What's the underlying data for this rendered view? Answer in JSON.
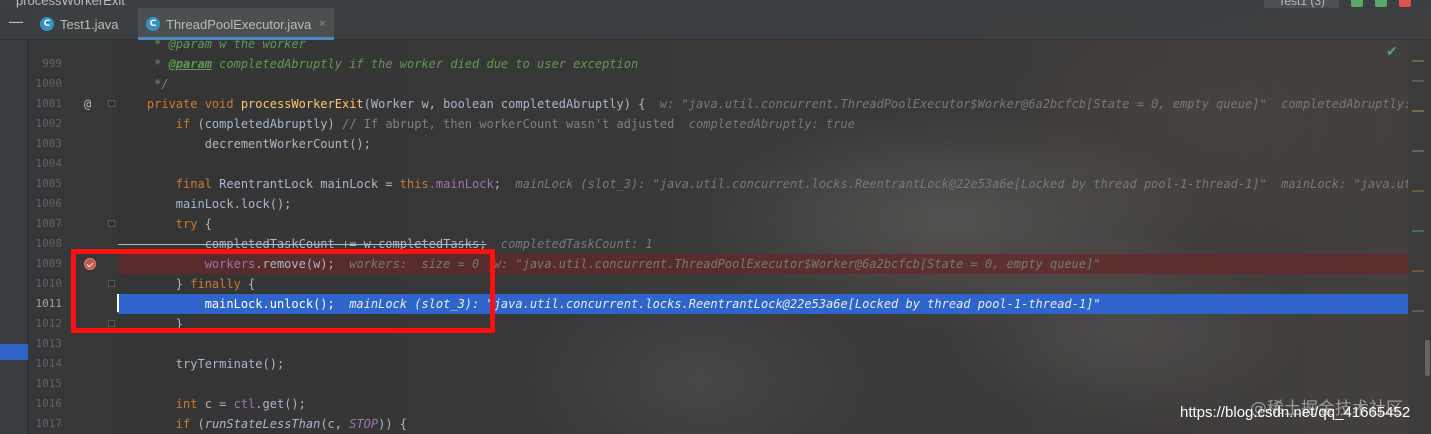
{
  "window": {
    "title": "processWorkerExit"
  },
  "toolbar": {
    "run_config": "Test1 (3)"
  },
  "tabs": [
    {
      "label": "Test1.java",
      "icon": "java-class-icon",
      "active": false
    },
    {
      "label": "ThreadPoolExecutor.java",
      "icon": "java-class-icon",
      "active": true,
      "close": "×"
    }
  ],
  "gutter": {
    "line_numbers": [
      "999",
      "1000",
      "1001",
      "1002",
      "1003",
      "1004",
      "1005",
      "1006",
      "1007",
      "1008",
      "1009",
      "1010",
      "1011",
      "1012",
      "1013",
      "1014",
      "1015",
      "1016",
      "1017"
    ],
    "first_partial": "",
    "override_marker": "@",
    "current_line": "1011",
    "breakpoint_line": "1009"
  },
  "code_lines": {
    "l998": "     * @param w the worker",
    "l999_a": "     * ",
    "l999_tag": "@param",
    "l999_b": " completedAbruptly if the worker died due to user exception",
    "l1000": "     */",
    "l1001_kw": "    private void ",
    "l1001_method": "processWorkerExit",
    "l1001_rest": "(Worker w, boolean completedAbruptly) {",
    "l1001_inline": "  w: \"java.util.concurrent.ThreadPoolExecutor$Worker@6a2bcfcb[State = 0, empty queue]\"  completedAbruptly: true",
    "l1002_kw": "        if ",
    "l1002_code": "(completedAbruptly) ",
    "l1002_comment": "// If abrupt, then workerCount wasn't adjusted",
    "l1002_inline": "  completedAbruptly: true",
    "l1003": "            decrementWorkerCount();",
    "l1005_kw": "        final ",
    "l1005_code": "ReentrantLock mainLock = ",
    "l1005_this": "this",
    "l1005_field": ".mainLock",
    "l1005_end": ";",
    "l1005_inline": "  mainLock (slot_3): \"java.util.concurrent.locks.ReentrantLock@22e53a6e[Locked by thread pool-1-thread-1]\"  mainLock: \"java.util.con",
    "l1006": "        mainLock.lock();",
    "l1007_kw": "        try ",
    "l1007_end": "{",
    "l1008_code": "            completedTaskCount += w.completedTasks;",
    "l1008_inline": "  completedTaskCount: 1",
    "l1009_field": "            workers",
    "l1009_code": ".remove(w);",
    "l1009_inline": "  workers:  size = 0  w: \"java.util.concurrent.ThreadPoolExecutor$Worker@6a2bcfcb[State = 0, empty queue]\"",
    "l1010_a": "        } ",
    "l1010_kw": "finally ",
    "l1010_b": "{",
    "l1011_code": "            mainLock.unlock();",
    "l1011_inline": "  mainLock (slot_3): \"java.util.concurrent.locks.ReentrantLock@22e53a6e[Locked by thread pool-1-thread-1]\"",
    "l1012": "        }",
    "l1014": "        tryTerminate();",
    "l1016_kw": "        int ",
    "l1016_code": "c = ",
    "l1016_field": "ctl",
    "l1016_end": ".get();",
    "l1017_kw": "        if ",
    "l1017_a": "(",
    "l1017_call": "runStateLessThan",
    "l1017_b": "(c, ",
    "l1017_const": "STOP",
    "l1017_c": ")) {"
  },
  "status": {
    "inspection": "✔"
  },
  "watermark": {
    "url": "https://blog.csdn.net/qq_41665452",
    "site": "@稀土掘金技术社区"
  },
  "colors": {
    "keyword": "#cc7832",
    "field": "#9876aa",
    "method": "#ffc66d",
    "exec_line": "#2f65ca",
    "breakpoint_line": "#64282a",
    "annotation_box": "#ff1010"
  }
}
